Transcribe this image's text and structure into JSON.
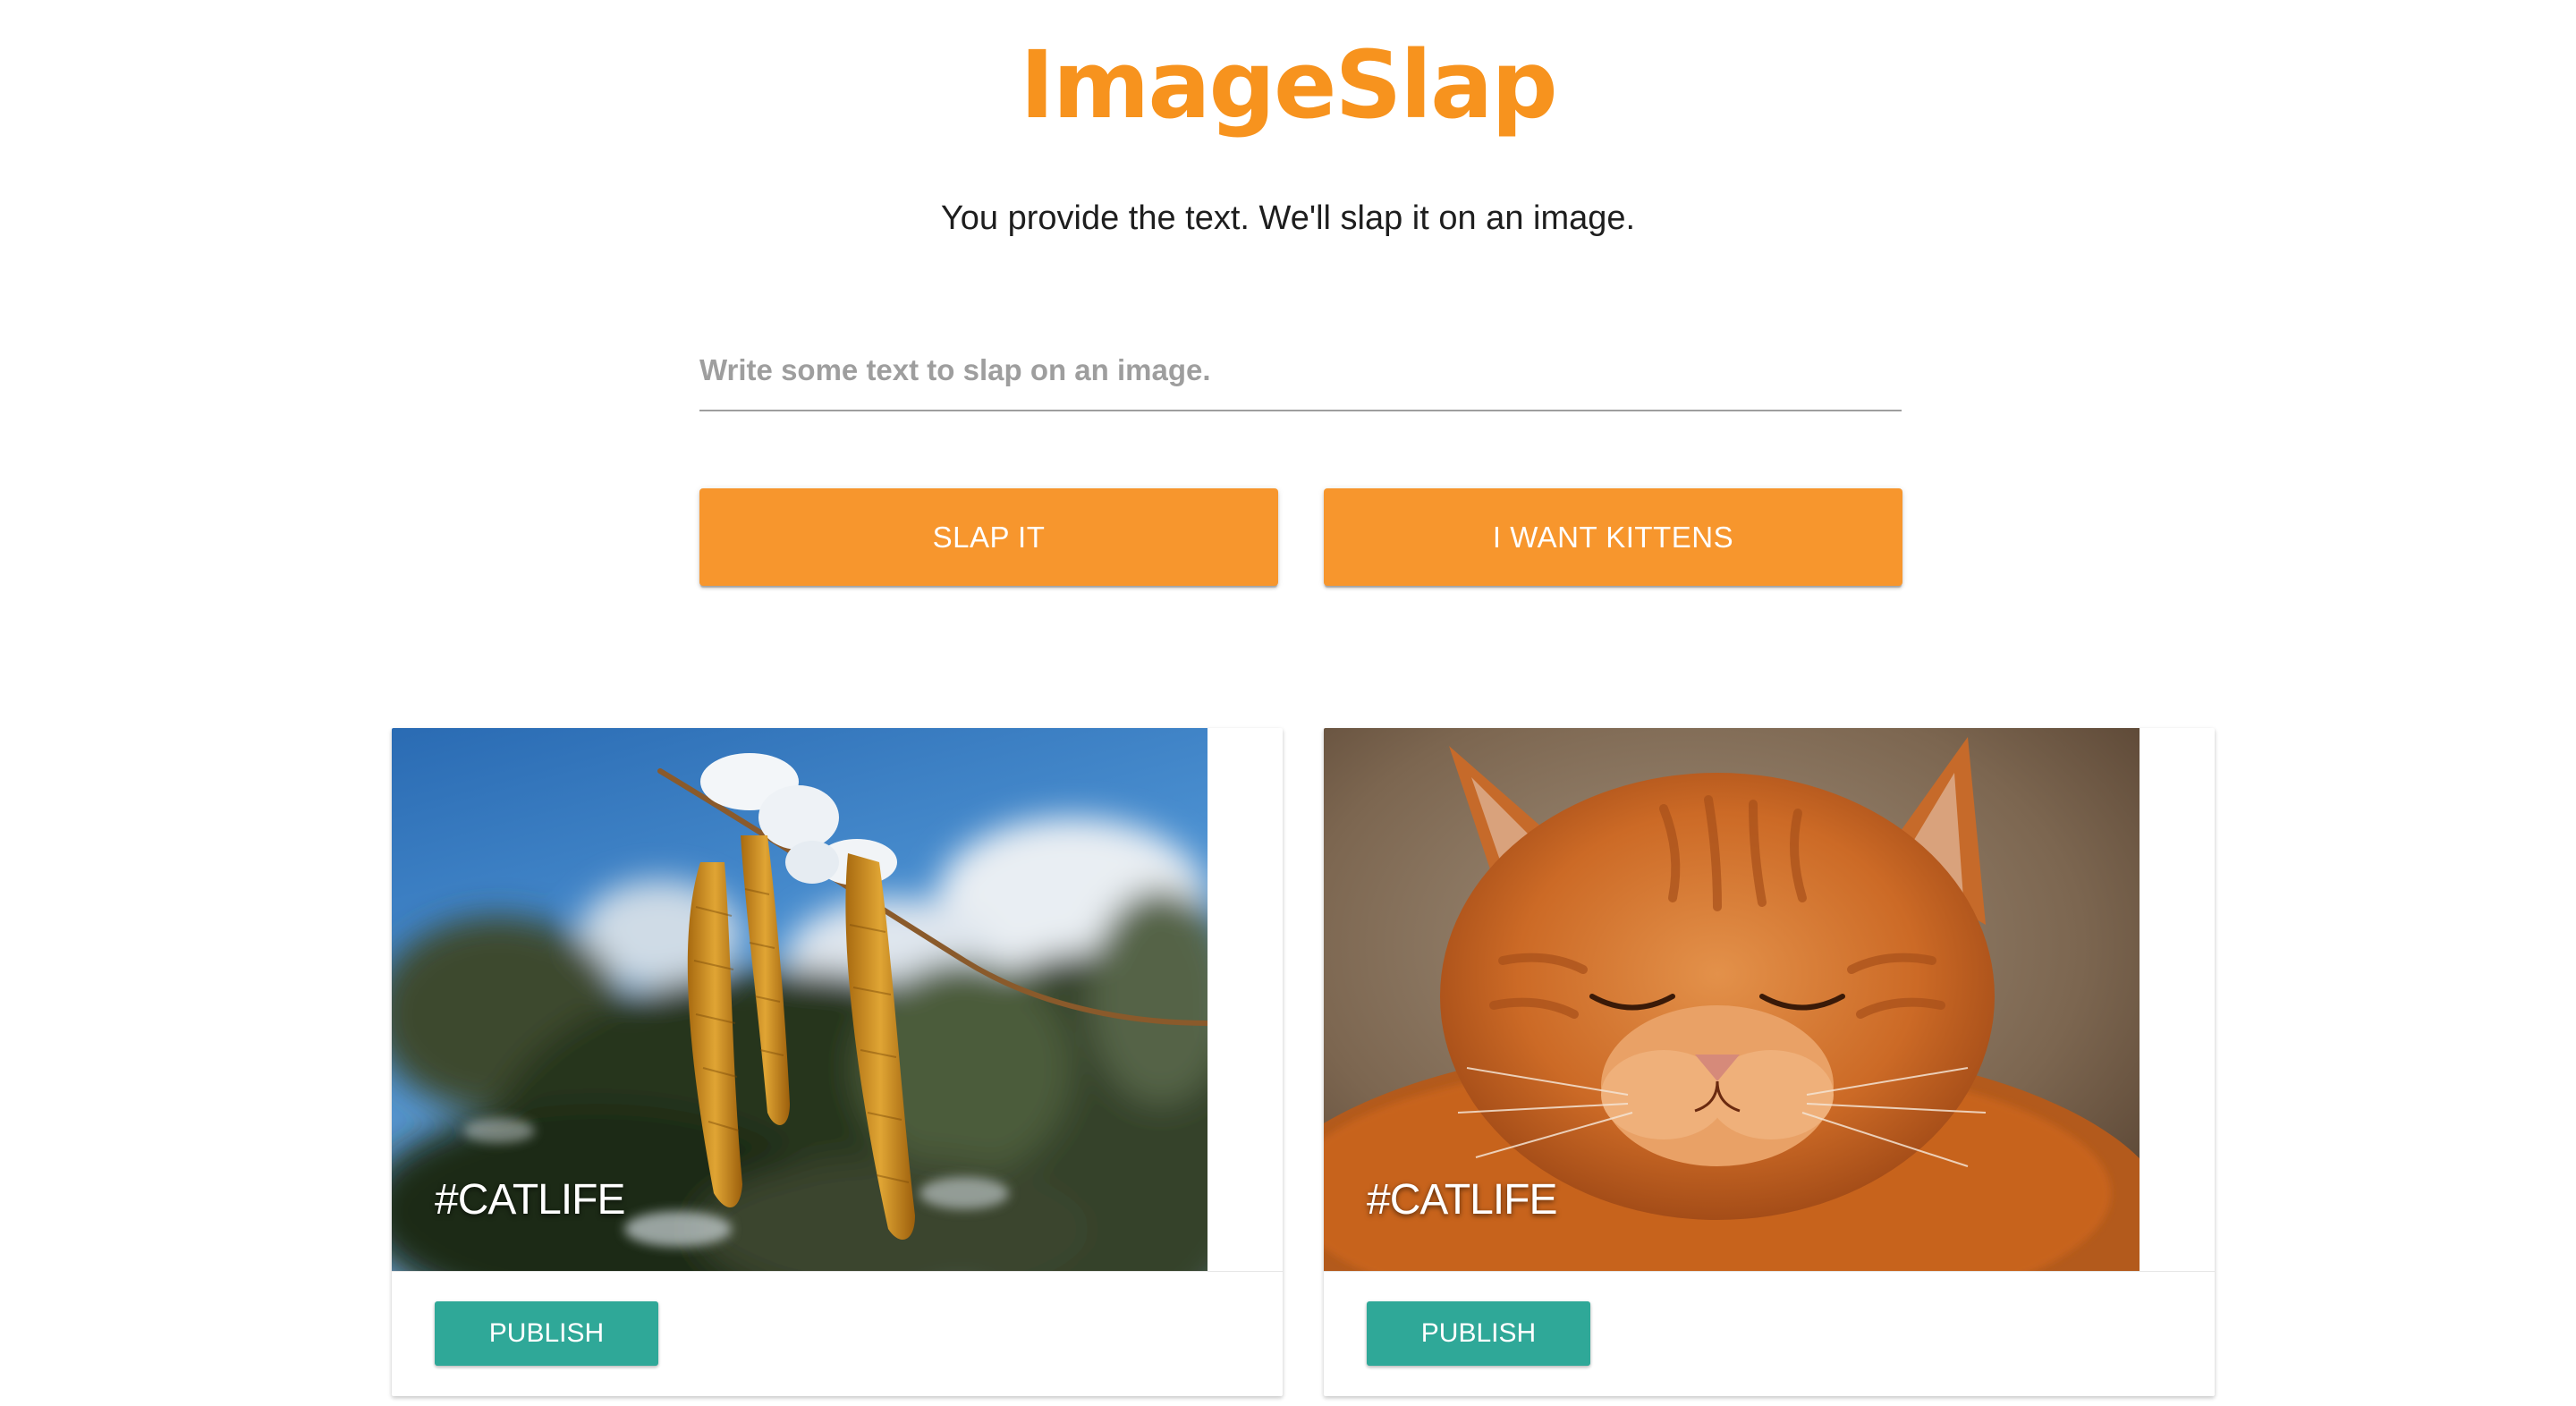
{
  "app": {
    "title": "ImageSlap",
    "tagline": "You provide the text. We'll slap it on an image."
  },
  "form": {
    "text_placeholder": "Write some text to slap on an image.",
    "text_value": "",
    "slap_button_label": "SLAP IT",
    "kittens_button_label": "I WANT KITTENS"
  },
  "cards": [
    {
      "caption": "#CATLIFE",
      "image_subject": "catkins-with-snow-photo",
      "publish_label": "PUBLISH"
    },
    {
      "caption": "#CATLIFE",
      "image_subject": "ginger-cat-photo",
      "publish_label": "PUBLISH"
    }
  ],
  "colors": {
    "brand_orange": "#f7962d",
    "title_orange": "#f7931e",
    "publish_teal": "#2fa898",
    "text_dark": "#1e1e1e",
    "placeholder_gray": "#9e9e9e"
  }
}
